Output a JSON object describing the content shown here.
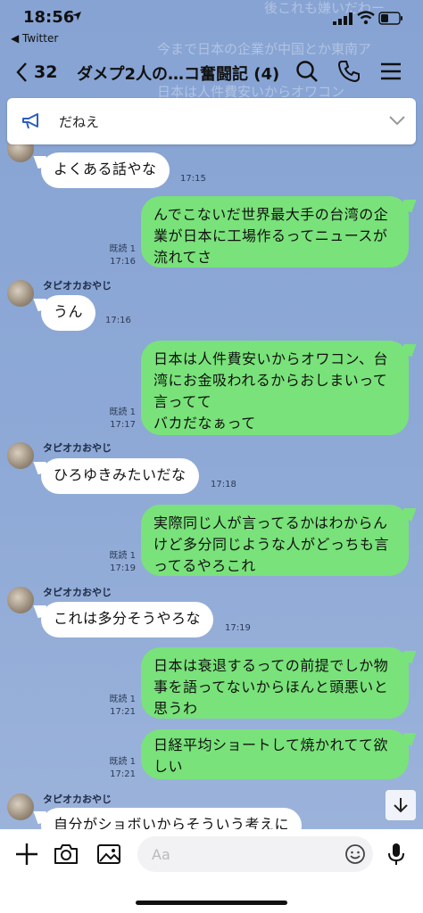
{
  "status_bar": {
    "time": "18:56",
    "back_app": "◀ Twitter"
  },
  "header": {
    "back_count": "32",
    "title": "ダメプ2人の…コ奮闘記 (4)"
  },
  "background_text": [
    "後これも嫌いだわー",
    "今まで日本の企業が中国とか東南ア",
    "日本は人件費安いからオワコン"
  ],
  "announcement": {
    "text": "だねえ"
  },
  "messages": [
    {
      "type": "in",
      "sender": "",
      "text": "よくある話やな",
      "time": "17:15"
    },
    {
      "type": "out",
      "text": "んでこないだ世界最大手の台湾の企\n業が日本に工場作るってニュースが\n流れてさ",
      "read": "既読 1",
      "time": "17:16"
    },
    {
      "type": "in",
      "sender": "タピオカおやじ",
      "text": "うん",
      "time": "17:16"
    },
    {
      "type": "out",
      "text": "日本は人件費安いからオワコン、台\n湾にお金吸われるからおしまいって\n言ってて\nバカだなぁって",
      "read": "既読 1",
      "time": "17:17"
    },
    {
      "type": "in",
      "sender": "タピオカおやじ",
      "text": "ひろゆきみたいだな",
      "time": "17:18"
    },
    {
      "type": "out",
      "text": "実際同じ人が言ってるかはわからん\nけど多分同じような人がどっちも言\nってるやろこれ",
      "read": "既読 1",
      "time": "17:19"
    },
    {
      "type": "in",
      "sender": "タピオカおやじ",
      "text": "これは多分そうやろな",
      "time": "17:19"
    },
    {
      "type": "out",
      "text": "日本は衰退するっての前提でしか物\n事を語ってないからほんと頭悪いと\n思うわ",
      "read": "既読 1",
      "time": "17:21"
    },
    {
      "type": "out",
      "text": "日経平均ショートして焼かれてて欲\nしい",
      "read": "既読 1",
      "time": "17:21"
    },
    {
      "type": "in",
      "sender": "タピオカおやじ",
      "text": "自分がショボいからそういう考えに",
      "time": ""
    }
  ],
  "input": {
    "placeholder": "Aa"
  },
  "colors": {
    "chat_bg": "#8aa6d4",
    "outgoing_bubble": "#79e27a",
    "incoming_bubble": "#ffffff"
  }
}
